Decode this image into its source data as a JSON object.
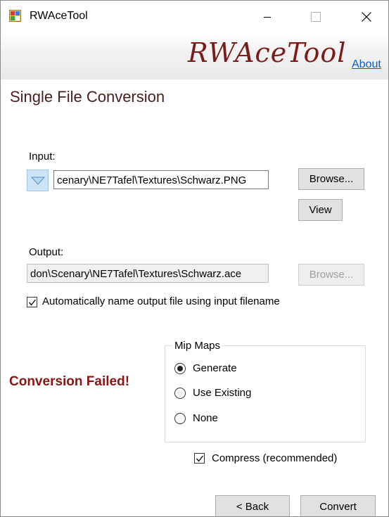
{
  "window": {
    "title": "RWAceTool"
  },
  "header": {
    "logo_text": "RWAceTool",
    "about_link": "About"
  },
  "page": {
    "title": "Single File Conversion"
  },
  "input": {
    "label": "Input:",
    "value": "cenary\\NE7Tafel\\Textures\\Schwarz.PNG",
    "browse_label": "Browse...",
    "view_label": "View"
  },
  "output": {
    "label": "Output:",
    "value": "don\\Scenary\\NE7Tafel\\Textures\\Schwarz.ace",
    "browse_label": "Browse...",
    "browse_enabled": false
  },
  "auto_name": {
    "label": "Automatically name output file using input filename",
    "checked": true
  },
  "status": {
    "text": "Conversion Failed!",
    "color": "#8b1414"
  },
  "mipmaps": {
    "title": "Mip Maps",
    "options": [
      {
        "label": "Generate",
        "selected": true
      },
      {
        "label": "Use Existing",
        "selected": false
      },
      {
        "label": "None",
        "selected": false
      }
    ]
  },
  "compress": {
    "label": "Compress (recommended)",
    "checked": true
  },
  "footer": {
    "back_label": "< Back",
    "convert_label": "Convert"
  }
}
